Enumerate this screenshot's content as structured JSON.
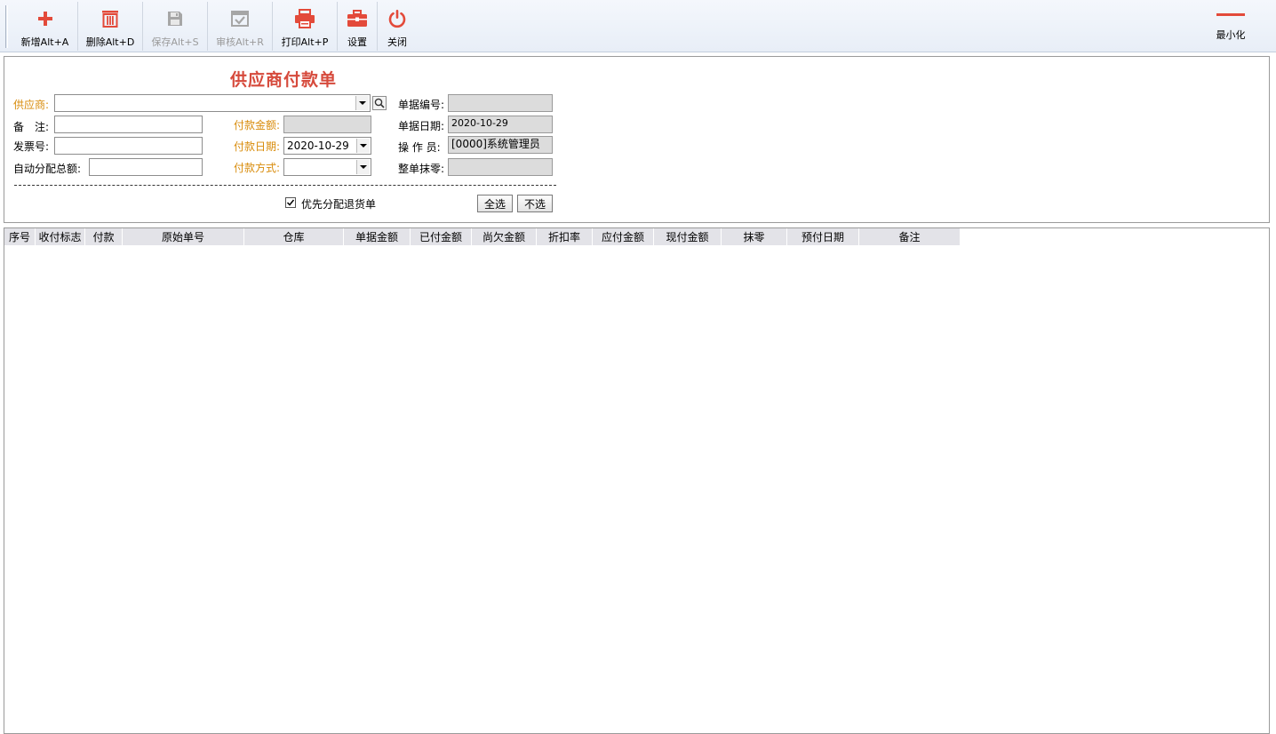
{
  "toolbar": {
    "buttons": [
      {
        "label": "新增Alt+A",
        "icon": "plus-icon",
        "color": "#e34a3a",
        "disabled": false
      },
      {
        "label": "删除Alt+D",
        "icon": "trash-icon",
        "color": "#e34a3a",
        "disabled": false
      },
      {
        "label": "保存Alt+S",
        "icon": "floppy-icon",
        "color": "#9a9a9a",
        "disabled": true
      },
      {
        "label": "审核Alt+R",
        "icon": "audit-icon",
        "color": "#9a9a9a",
        "disabled": true
      },
      {
        "label": "打印Alt+P",
        "icon": "printer-icon",
        "color": "#e34a3a",
        "disabled": false
      },
      {
        "label": "设置",
        "icon": "toolbox-icon",
        "color": "#e34a3a",
        "disabled": false
      },
      {
        "label": "关闭",
        "icon": "power-icon",
        "color": "#e34a3a",
        "disabled": false
      }
    ],
    "minimize_label": "最小化"
  },
  "form": {
    "title": "供应商付款单",
    "supplier_label": "供应商:",
    "supplier_value": "",
    "remark_label": "备　注:",
    "remark_value": "",
    "invoice_label": "发票号:",
    "invoice_value": "",
    "auto_total_label": "自动分配总额:",
    "auto_total_value": "",
    "amount_label": "付款金额:",
    "amount_value": "",
    "pay_date_label": "付款日期:",
    "pay_date_value": "2020-10-29",
    "pay_method_label": "付款方式:",
    "pay_method_value": "",
    "doc_no_label": "单据编号:",
    "doc_no_value": "",
    "doc_date_label": "单据日期:",
    "doc_date_value": "2020-10-29",
    "operator_label": "操 作 员:",
    "operator_value": "[0000]系统管理员",
    "rounding_label": "整单抹零:",
    "rounding_value": "",
    "priority_return_label": "优先分配退货单",
    "priority_return_checked": true,
    "select_all_label": "全选",
    "select_none_label": "不选"
  },
  "grid": {
    "columns": [
      "序号",
      "收付标志",
      "付款",
      "原始单号",
      "仓库",
      "单据金额",
      "已付金额",
      "尚欠金额",
      "折扣率",
      "应付金额",
      "现付金额",
      "抹零",
      "预付日期",
      "备注"
    ],
    "rows": []
  },
  "colors": {
    "accent": "#e34a3a",
    "title": "#d64a3c",
    "orange_label": "#d88b0a"
  }
}
